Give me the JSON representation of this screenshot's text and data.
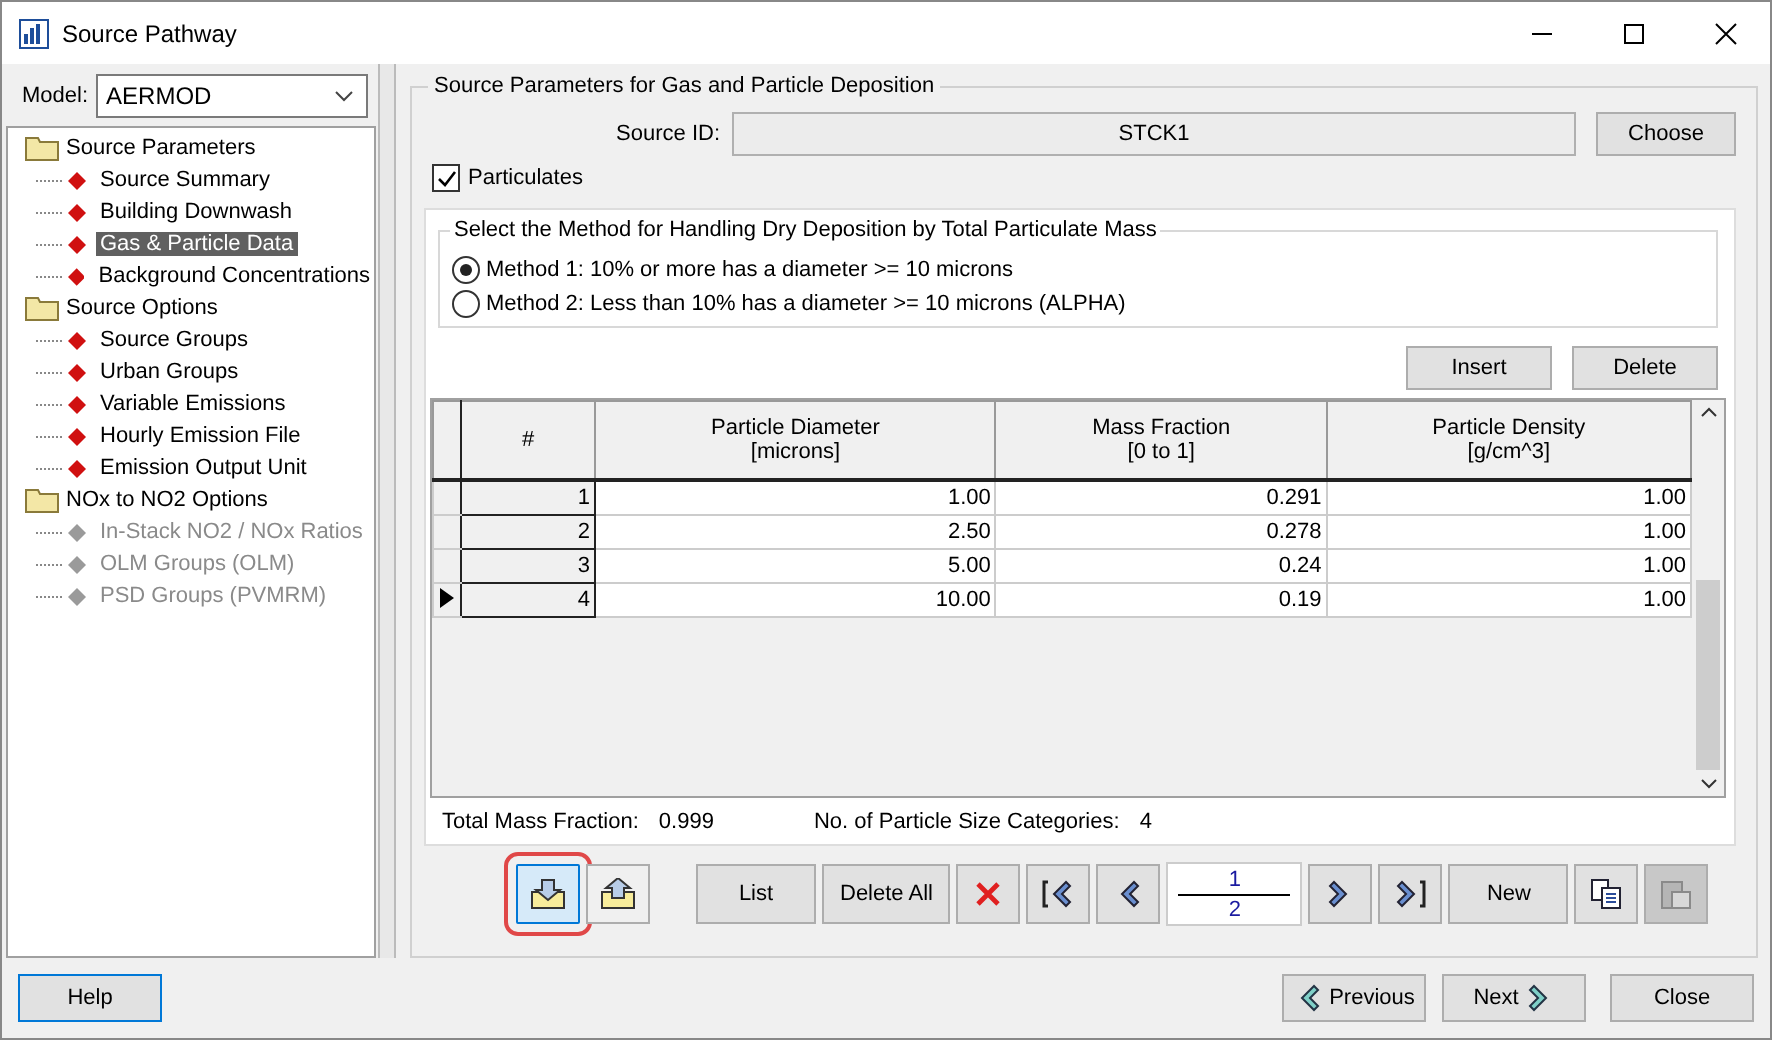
{
  "window": {
    "title": "Source Pathway"
  },
  "model": {
    "label": "Model:",
    "value": "AERMOD"
  },
  "tree": [
    {
      "label": "Source Parameters",
      "children": [
        {
          "label": "Source Summary",
          "selected": false,
          "disabled": false
        },
        {
          "label": "Building Downwash",
          "selected": false,
          "disabled": false
        },
        {
          "label": "Gas & Particle Data",
          "selected": true,
          "disabled": false
        },
        {
          "label": "Background Concentrations",
          "selected": false,
          "disabled": false
        }
      ]
    },
    {
      "label": "Source Options",
      "children": [
        {
          "label": "Source Groups",
          "selected": false,
          "disabled": false
        },
        {
          "label": "Urban Groups",
          "selected": false,
          "disabled": false
        },
        {
          "label": "Variable Emissions",
          "selected": false,
          "disabled": false
        },
        {
          "label": "Hourly Emission File",
          "selected": false,
          "disabled": false
        },
        {
          "label": "Emission Output Unit",
          "selected": false,
          "disabled": false
        }
      ]
    },
    {
      "label": "NOx to NO2 Options",
      "children": [
        {
          "label": "In-Stack NO2 / NOx Ratios",
          "selected": false,
          "disabled": true
        },
        {
          "label": "OLM Groups (OLM)",
          "selected": false,
          "disabled": true
        },
        {
          "label": "PSD Groups (PVMRM)",
          "selected": false,
          "disabled": true
        }
      ]
    }
  ],
  "panel": {
    "title": "Source Parameters for Gas and Particle Deposition",
    "source_id_label": "Source ID:",
    "source_id": "STCK1",
    "choose_button": "Choose",
    "particulates": {
      "label": "Particulates",
      "checked": true
    }
  },
  "method": {
    "title": "Select the Method for Handling Dry Deposition by Total Particulate Mass",
    "options": [
      {
        "label": "Method 1: 10% or more has a diameter >= 10 microns",
        "selected": true
      },
      {
        "label": "Method 2: Less than 10% has a diameter >= 10 microns (ALPHA)",
        "selected": false
      }
    ]
  },
  "grid_buttons": [
    "Insert",
    "Delete"
  ],
  "table": {
    "columns": [
      {
        "lines": [
          "#"
        ]
      },
      {
        "lines": [
          "Particle Diameter",
          "[microns]"
        ]
      },
      {
        "lines": [
          "Mass Fraction",
          "[0 to 1]"
        ]
      },
      {
        "lines": [
          "Particle Density",
          "[g/cm^3]"
        ]
      }
    ],
    "rows": [
      {
        "cells": [
          "1",
          "1.00",
          "0.291",
          "1.00"
        ],
        "selected": false
      },
      {
        "cells": [
          "2",
          "2.50",
          "0.278",
          "1.00"
        ],
        "selected": false
      },
      {
        "cells": [
          "3",
          "5.00",
          "0.24",
          "1.00"
        ],
        "selected": false
      },
      {
        "cells": [
          "4",
          "10.00",
          "0.19",
          "1.00"
        ],
        "selected": true
      }
    ]
  },
  "summary": [
    {
      "label": "Total Mass Fraction:",
      "value": "0.999"
    },
    {
      "label": "No. of Particle Size Categories:",
      "value": "4"
    }
  ],
  "toolbar": [
    {
      "kind": "import",
      "highlighted": true,
      "disabled": false
    },
    {
      "kind": "export",
      "highlighted": false,
      "disabled": false
    },
    {
      "kind": "button",
      "label": "List",
      "highlighted": false,
      "disabled": false
    },
    {
      "kind": "button",
      "label": "Delete All",
      "highlighted": false,
      "disabled": false
    },
    {
      "kind": "delete",
      "highlighted": false,
      "disabled": false
    },
    {
      "kind": "first",
      "highlighted": false,
      "disabled": false
    },
    {
      "kind": "prev",
      "highlighted": false,
      "disabled": false
    },
    {
      "kind": "page",
      "current": "1",
      "total": "2"
    },
    {
      "kind": "next",
      "highlighted": false,
      "disabled": false
    },
    {
      "kind": "last",
      "highlighted": false,
      "disabled": false
    },
    {
      "kind": "button",
      "label": "New",
      "highlighted": false,
      "disabled": false
    },
    {
      "kind": "copy",
      "highlighted": false,
      "disabled": false
    },
    {
      "kind": "paste",
      "highlighted": false,
      "disabled": true
    }
  ],
  "footer": {
    "help": "Help",
    "previous": "Previous",
    "next": "Next",
    "close": "Close"
  }
}
